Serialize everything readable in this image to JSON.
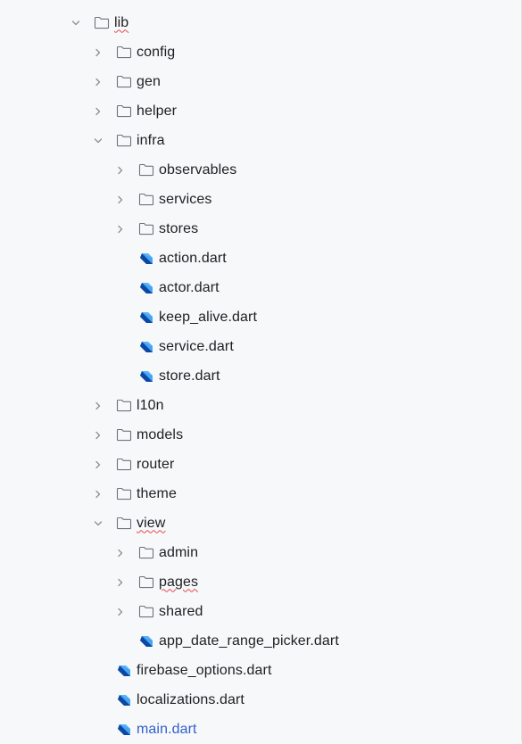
{
  "tree": {
    "items": [
      {
        "label": "lib",
        "kind": "folder",
        "state": "expanded",
        "depth": 0,
        "spell": true
      },
      {
        "label": "config",
        "kind": "folder",
        "state": "collapsed",
        "depth": 1
      },
      {
        "label": "gen",
        "kind": "folder",
        "state": "collapsed",
        "depth": 1
      },
      {
        "label": "helper",
        "kind": "folder",
        "state": "collapsed",
        "depth": 1
      },
      {
        "label": "infra",
        "kind": "folder",
        "state": "expanded",
        "depth": 1
      },
      {
        "label": "observables",
        "kind": "folder",
        "state": "collapsed",
        "depth": 2
      },
      {
        "label": "services",
        "kind": "folder",
        "state": "collapsed",
        "depth": 2
      },
      {
        "label": "stores",
        "kind": "folder",
        "state": "collapsed",
        "depth": 2
      },
      {
        "label": "action.dart",
        "kind": "dart",
        "depth": 2
      },
      {
        "label": "actor.dart",
        "kind": "dart",
        "depth": 2
      },
      {
        "label": "keep_alive.dart",
        "kind": "dart",
        "depth": 2
      },
      {
        "label": "service.dart",
        "kind": "dart",
        "depth": 2
      },
      {
        "label": "store.dart",
        "kind": "dart",
        "depth": 2
      },
      {
        "label": "l10n",
        "kind": "folder",
        "state": "collapsed",
        "depth": 1
      },
      {
        "label": "models",
        "kind": "folder",
        "state": "collapsed",
        "depth": 1
      },
      {
        "label": "router",
        "kind": "folder",
        "state": "collapsed",
        "depth": 1
      },
      {
        "label": "theme",
        "kind": "folder",
        "state": "collapsed",
        "depth": 1
      },
      {
        "label": "view",
        "kind": "folder",
        "state": "expanded",
        "depth": 1,
        "spell": true
      },
      {
        "label": "admin",
        "kind": "folder",
        "state": "collapsed",
        "depth": 2
      },
      {
        "label": "pages",
        "kind": "folder",
        "state": "collapsed",
        "depth": 2,
        "spell": true
      },
      {
        "label": "shared",
        "kind": "folder",
        "state": "collapsed",
        "depth": 2
      },
      {
        "label": "app_date_range_picker.dart",
        "kind": "dart",
        "depth": 2
      },
      {
        "label": "firebase_options.dart",
        "kind": "dart",
        "depth": 1
      },
      {
        "label": "localizations.dart",
        "kind": "dart",
        "depth": 1
      },
      {
        "label": "main.dart",
        "kind": "dart",
        "depth": 1,
        "highlight": true
      }
    ]
  },
  "colors": {
    "background": "#f7f8fa",
    "text": "#1e1f22",
    "chevron": "#8c8f94",
    "folder_stroke": "#6f737a",
    "dart_light": "#42a5f5",
    "dart_dark": "#0d47a1",
    "link_text": "#2f5fd0",
    "spell_error": "#e5484d"
  }
}
